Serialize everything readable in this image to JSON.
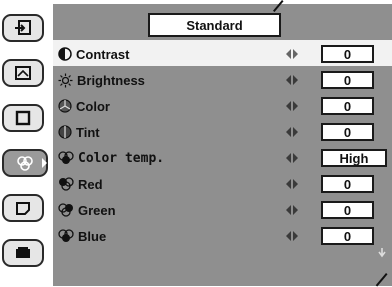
{
  "title": "Standard",
  "sidebar": {
    "tabs": [
      {
        "icon": "input-icon",
        "active": false
      },
      {
        "icon": "screen-icon",
        "active": false
      },
      {
        "icon": "square-icon",
        "active": false
      },
      {
        "icon": "image-adjust-icon",
        "active": true
      },
      {
        "icon": "picture-icon",
        "active": false
      },
      {
        "icon": "projector-icon",
        "active": false
      }
    ]
  },
  "rows": [
    {
      "icon": "contrast-icon",
      "label": "Contrast",
      "value": "0"
    },
    {
      "icon": "brightness-icon",
      "label": "Brightness",
      "value": "0"
    },
    {
      "icon": "color-icon",
      "label": "Color",
      "value": "0"
    },
    {
      "icon": "tint-icon",
      "label": "Tint",
      "value": "0"
    },
    {
      "icon": "color-temp-icon",
      "label": "Color temp.",
      "value": "High"
    },
    {
      "icon": "red-icon",
      "label": "Red",
      "value": "0"
    },
    {
      "icon": "green-icon",
      "label": "Green",
      "value": "0"
    },
    {
      "icon": "blue-icon",
      "label": "Blue",
      "value": "0"
    }
  ]
}
